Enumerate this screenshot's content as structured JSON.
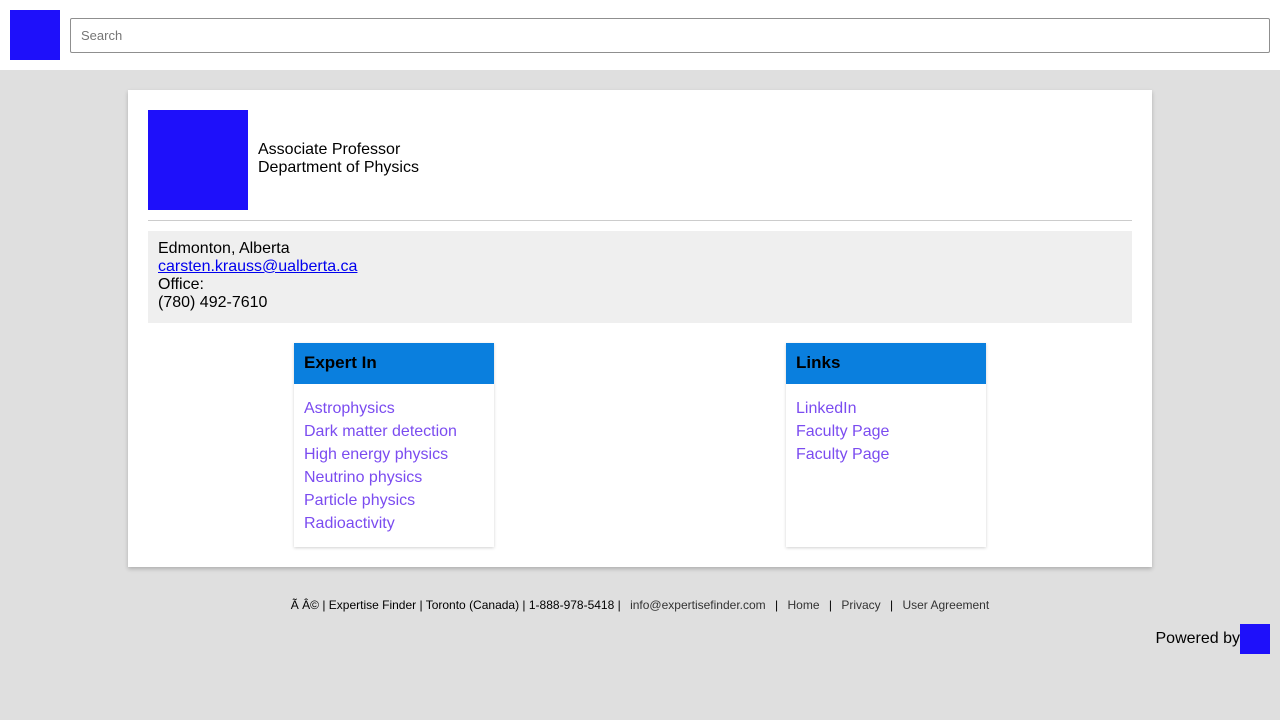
{
  "colors": {
    "accent": "#1e10fa",
    "panel_header": "#0a7fde",
    "link": "#7b4cf0",
    "page_bg": "#dfdfdf"
  },
  "header": {
    "logo_icon": "site-logo-icon",
    "search_placeholder": "Search",
    "search_value": ""
  },
  "profile": {
    "photo_icon": "profile-photo",
    "title": "Associate Professor",
    "department": "Department of Physics",
    "location": "Edmonton, Alberta",
    "email": "carsten.krauss@ualberta.ca",
    "office_label": "Office:",
    "phone": "(780) 492-7610"
  },
  "expert_in": {
    "heading": "Expert In",
    "items": [
      "Astrophysics",
      "Dark matter detection",
      "High energy physics",
      "Neutrino physics",
      "Particle physics",
      "Radioactivity"
    ]
  },
  "links": {
    "heading": "Links",
    "items": [
      "LinkedIn",
      "Faculty Page",
      "Faculty Page"
    ]
  },
  "footer": {
    "copyright": "Ã   Â© | Expertise Finder | Toronto (Canada) | 1-888-978-5418 |",
    "email": "info@expertisefinder.com",
    "home": "Home",
    "privacy": "Privacy",
    "agreement": "User Agreement",
    "separator": "|",
    "powered_by": "Powered by"
  }
}
